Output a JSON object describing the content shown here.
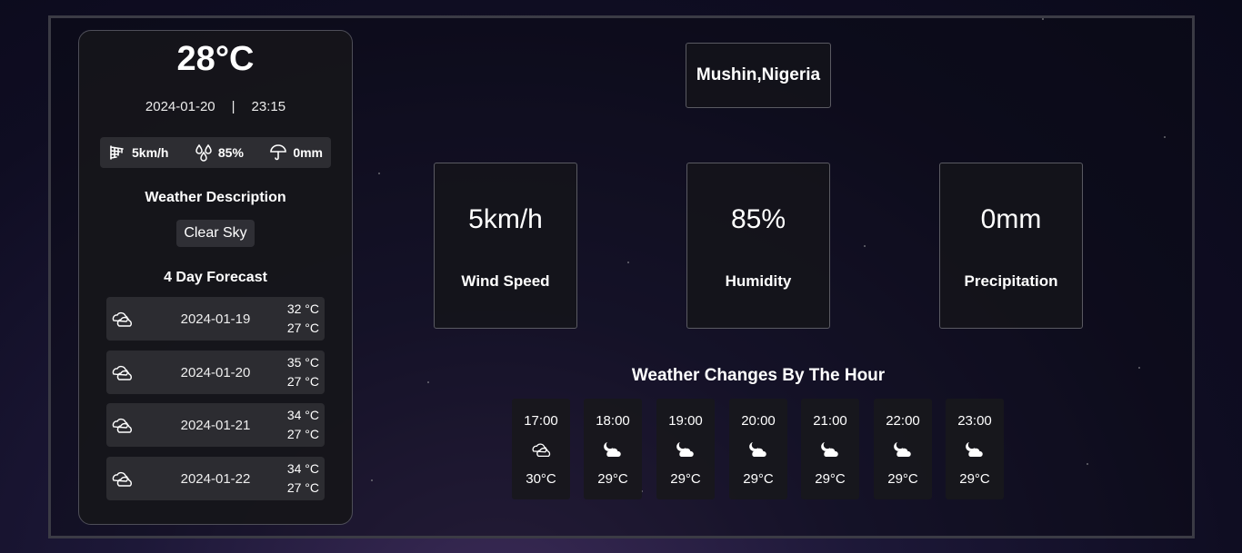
{
  "current": {
    "temperature": "28°C",
    "date": "2024-01-20",
    "separator": "|",
    "time": "23:15"
  },
  "stats": {
    "wind": {
      "value": "5km/h",
      "icon": "wind-icon"
    },
    "humidity": {
      "value": "85%",
      "icon": "droplets-icon"
    },
    "precipitation": {
      "value": "0mm",
      "icon": "umbrella-icon"
    }
  },
  "description": {
    "heading": "Weather Description",
    "value": "Clear Sky"
  },
  "forecast": {
    "heading": "4 Day Forecast",
    "days": [
      {
        "date": "2024-01-19",
        "high": "32 °C",
        "low": "27 °C",
        "icon": "clouds-icon"
      },
      {
        "date": "2024-01-20",
        "high": "35 °C",
        "low": "27 °C",
        "icon": "clouds-icon"
      },
      {
        "date": "2024-01-21",
        "high": "34 °C",
        "low": "27 °C",
        "icon": "clouds-icon"
      },
      {
        "date": "2024-01-22",
        "high": "34 °C",
        "low": "27 °C",
        "icon": "clouds-icon"
      }
    ]
  },
  "location": "Mushin,Nigeria",
  "metrics": [
    {
      "value": "5km/h",
      "label": "Wind Speed"
    },
    {
      "value": "85%",
      "label": "Humidity"
    },
    {
      "value": "0mm",
      "label": "Precipitation"
    }
  ],
  "hourly": {
    "title": "Weather Changes By The Hour",
    "hours": [
      {
        "time": "17:00",
        "temp": "30°C",
        "icon": "clouds-icon"
      },
      {
        "time": "18:00",
        "temp": "29°C",
        "icon": "cloudy-night-icon"
      },
      {
        "time": "19:00",
        "temp": "29°C",
        "icon": "cloudy-night-icon"
      },
      {
        "time": "20:00",
        "temp": "29°C",
        "icon": "cloudy-night-icon"
      },
      {
        "time": "21:00",
        "temp": "29°C",
        "icon": "cloudy-night-icon"
      },
      {
        "time": "22:00",
        "temp": "29°C",
        "icon": "cloudy-night-icon"
      },
      {
        "time": "23:00",
        "temp": "29°C",
        "icon": "cloudy-night-icon"
      }
    ]
  }
}
